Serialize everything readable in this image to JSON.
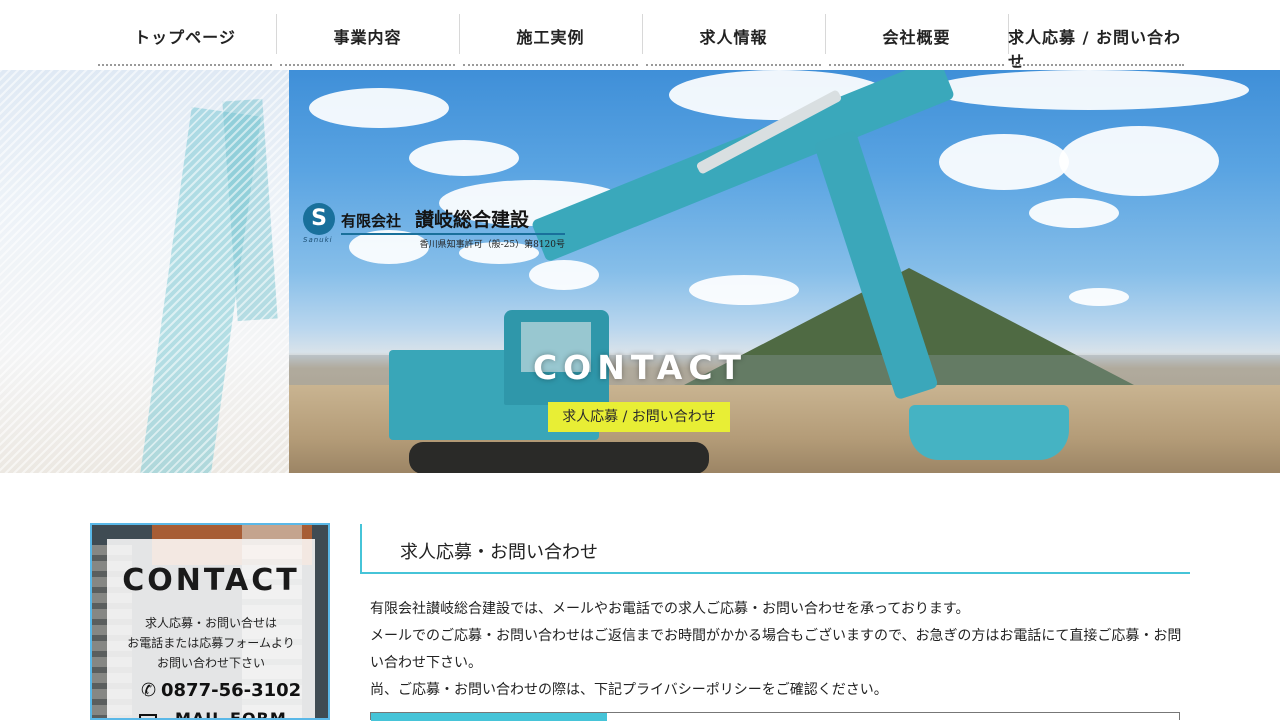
{
  "nav": {
    "items": [
      {
        "label": "トップページ"
      },
      {
        "label": "事業内容"
      },
      {
        "label": "施工実例"
      },
      {
        "label": "求人情報"
      },
      {
        "label": "会社概要"
      },
      {
        "label": "求人応募 / お問い合わせ"
      }
    ]
  },
  "logo": {
    "mark": "S",
    "en": "Sanuki",
    "prefix": "有限会社",
    "name": "讃岐総合建設",
    "permit": "香川県知事許可（般-25）第8120号"
  },
  "hero": {
    "title": "CONTACT",
    "badge": "求人応募 / お問い合わせ"
  },
  "sidebar": {
    "title": "CONTACT",
    "text_line1": "求人応募・お問い合せは",
    "text_line2": "お電話または応募フォームより",
    "text_line3": "お問い合わせ下さい",
    "tel_icon": "phone-icon",
    "tel": "0877-56-3102",
    "mail_icon": "mail-icon",
    "mail": "MAIL FORM"
  },
  "main": {
    "heading": "求人応募・お問い合わせ",
    "para1": "有限会社讃岐総合建設では、メールやお電話での求人ご応募・お問い合わせを承っております。",
    "para2": "メールでのご応募・お問い合わせはご返信までお時間がかかる場合もございますので、お急ぎの方はお電話にて直接ご応募・お問い合わせ下さい。",
    "para3": "尚、ご応募・お問い合わせの際は、下記プライバシーポリシーをご確認ください。"
  },
  "colors": {
    "accent": "#46c4d8",
    "badge": "#e8ee35",
    "logo_blue": "#19709b"
  }
}
